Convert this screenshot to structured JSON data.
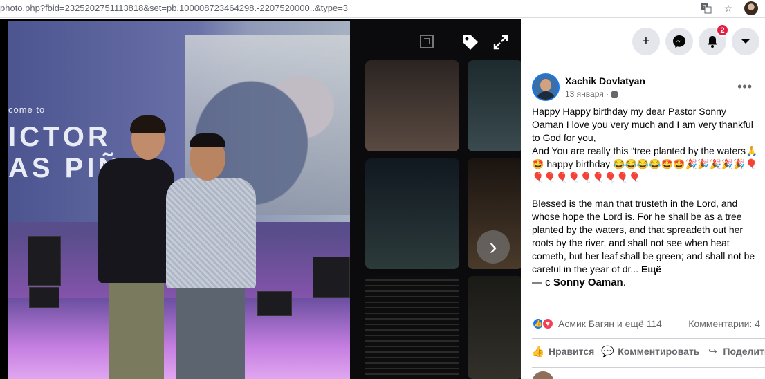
{
  "browser": {
    "url": "photo.php?fbid=2325202751113818&set=pb.100008723464298.-2207520000..&type=3",
    "icons": [
      "translate-icon",
      "star-icon",
      "profile-avatar"
    ]
  },
  "photo": {
    "screen_line1": "come to",
    "screen_line2": "ICTOR",
    "screen_line3": "AS PIÑ S",
    "viewer_icons": [
      "frame-icon",
      "tag-icon",
      "fullscreen-icon"
    ],
    "next_label": "›"
  },
  "topbar": {
    "create_label": "+",
    "messenger_icon": "messenger-icon",
    "notifications_count": "2",
    "menu_icon": "caret-down-icon"
  },
  "post": {
    "author": "Xachik Dovlatyan",
    "date": "13 января ·",
    "more": "•••",
    "text_line1": "Happy Happy birthday my dear Pastor Sonny Oaman I love you very much and I am very thankful to God for you,",
    "text_line2": "And You are really this “tree planted by the waters🙏🤩 happy birthday 😂😂😂😂🤩🤩🎉🎉🎉🎉🎉🎈🎈🎈🎈🎈🎈🎈🎈🎈🎈",
    "text_line3": "Blessed is the man that trusteth in the Lord, and whose hope the Lord is. For he shall be as a tree planted by the waters, and that spreadeth out her roots by the river, and shall not see when heat cometh, but her leaf shall be green; and shall not be careful in the year of dr...",
    "see_more": "Ещё",
    "with_prefix": "— с",
    "with_name": "Sonny Oaman",
    "with_suffix": "."
  },
  "reactions": {
    "names": "Асмик Багян и ещё 114",
    "comments": "Комментарии: 4"
  },
  "actions": {
    "like": "Нравится",
    "comment": "Комментировать",
    "share": "Поделиться"
  },
  "colors": {
    "accent": "#1877f2",
    "badge": "#e41e3f",
    "love": "#f33e58"
  }
}
